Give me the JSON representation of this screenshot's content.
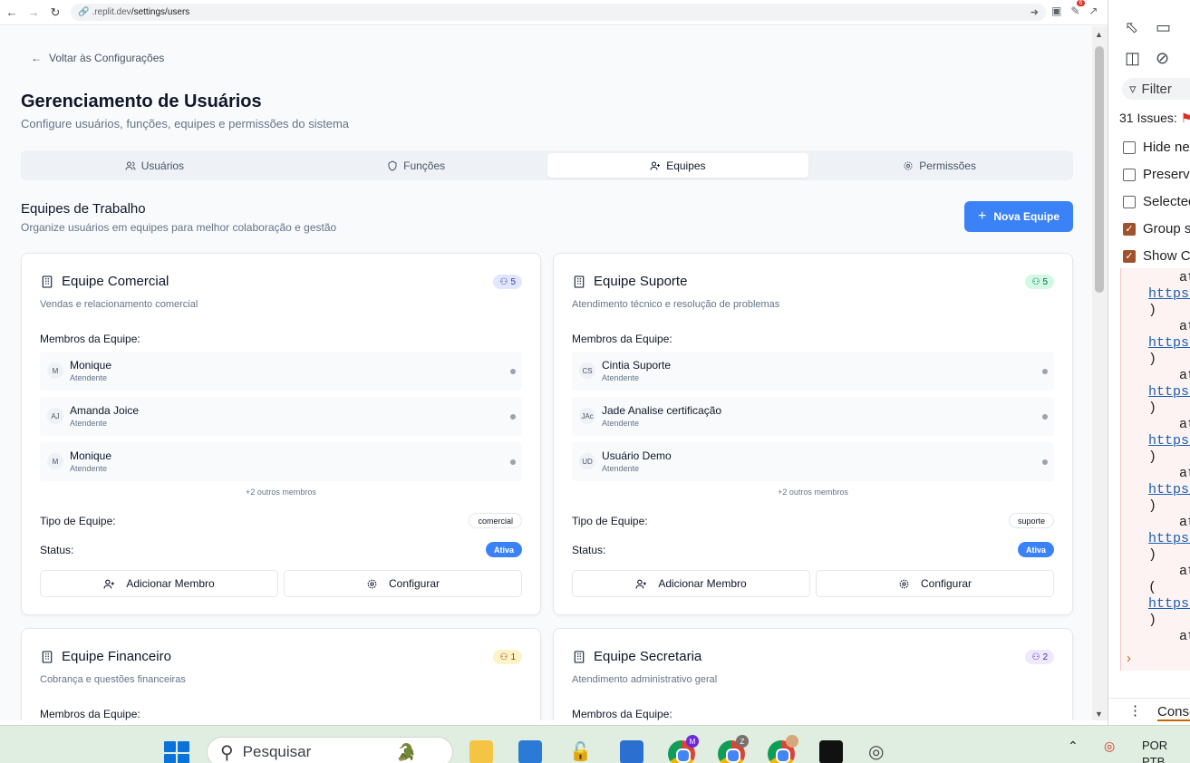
{
  "browser": {
    "url_domain": ".replit.dev",
    "url_path": "/settings/users",
    "extension_badge": "6"
  },
  "page": {
    "back_link": "Voltar às Configurações",
    "title": "Gerenciamento de Usuários",
    "subtitle": "Configure usuários, funções, equipes e permissões do sistema",
    "tabs": [
      {
        "label": "Usuários"
      },
      {
        "label": "Funções"
      },
      {
        "label": "Equipes"
      },
      {
        "label": "Permissões"
      }
    ],
    "active_tab": "Equipes",
    "section_title": "Equipes de Trabalho",
    "section_subtitle": "Organize usuários em equipes para melhor colaboração e gestão",
    "new_team_button": "Nova Equipe",
    "members_label": "Membros da Equipe:",
    "type_label": "Tipo de Equipe:",
    "status_label": "Status:",
    "add_member_button": "Adicionar Membro",
    "configure_button": "Configurar",
    "teams": [
      {
        "name": "Equipe Comercial",
        "count": "5",
        "badge_bg": "#e0e7ff",
        "badge_fg": "#3730a3",
        "description": "Vendas e relacionamento comercial",
        "members": [
          {
            "initials": "M",
            "name": "Monique",
            "role": "Atendente"
          },
          {
            "initials": "AJ",
            "name": "Amanda Joice",
            "role": "Atendente"
          },
          {
            "initials": "M",
            "name": "Monique",
            "role": "Atendente"
          }
        ],
        "more_members": "+2 outros membros",
        "type": "comercial",
        "status": "Ativa"
      },
      {
        "name": "Equipe Suporte",
        "count": "5",
        "badge_bg": "#d1fae5",
        "badge_fg": "#065f46",
        "description": "Atendimento técnico e resolução de problemas",
        "members": [
          {
            "initials": "CS",
            "name": "Cintia Suporte",
            "role": "Atendente"
          },
          {
            "initials": "JAc",
            "name": "Jade Analise certificação",
            "role": "Atendente"
          },
          {
            "initials": "UD",
            "name": "Usuário Demo",
            "role": "Atendente"
          }
        ],
        "more_members": "+2 outros membros",
        "type": "suporte",
        "status": "Ativa"
      },
      {
        "name": "Equipe Financeiro",
        "count": "1",
        "badge_bg": "#fef3c7",
        "badge_fg": "#92400e",
        "description": "Cobrança e questões financeiras"
      },
      {
        "name": "Equipe Secretaria",
        "count": "2",
        "badge_bg": "#ede9fe",
        "badge_fg": "#5b21b6",
        "description": "Atendimento administrativo geral"
      }
    ]
  },
  "devtools": {
    "filter": "Filter",
    "issues": "31 Issues:",
    "checkboxes": [
      {
        "label": "Hide ne",
        "checked": false
      },
      {
        "label": "Preserve",
        "checked": false
      },
      {
        "label": "Selected",
        "checked": false
      },
      {
        "label": "Group s",
        "checked": true
      },
      {
        "label": "Show CO",
        "checked": true
      }
    ],
    "console_at": "at",
    "console_link": "https:",
    "console_close": ")",
    "console_open": "(",
    "bottom_tab": "Conso"
  },
  "taskbar": {
    "search_placeholder": "Pesquisar",
    "lang_top": "POR",
    "lang_bottom": "PTB",
    "chrome_profiles": [
      {
        "letter": "M",
        "color": "#6d28d9"
      },
      {
        "letter": "Z",
        "color": "#78716c"
      },
      {
        "letter": "",
        "color": "#d6a77a"
      }
    ]
  }
}
